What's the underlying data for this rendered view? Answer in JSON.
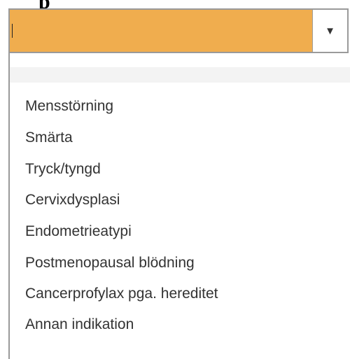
{
  "heading": "p",
  "combo": {
    "input_value": "",
    "toggle_icon": "▼",
    "input_color": "#f0ad4e"
  },
  "dropdown": {
    "options": [
      "Mensstörning",
      "Smärta",
      "Tryck/tyngd",
      "Cervixdysplasi",
      "Endometrieatypi",
      "Postmenopausal blödning",
      "Cancerprofylax pga. hereditet",
      "Annan indikation"
    ]
  }
}
